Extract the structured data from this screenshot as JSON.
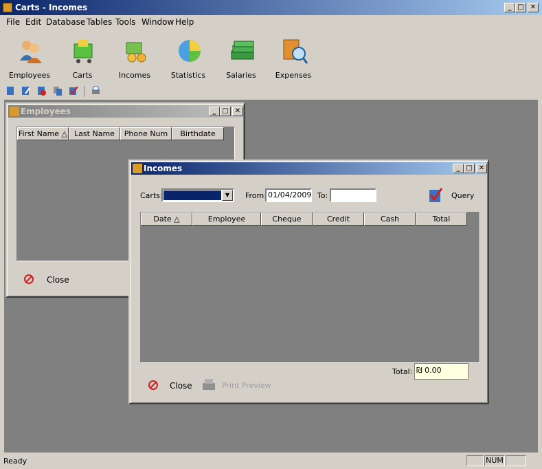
{
  "app": {
    "title": "Carts - Incomes"
  },
  "menu": {
    "file": "File",
    "edit": "Edit",
    "database": "Database",
    "tables": "Tables",
    "tools": "Tools",
    "window": "Window",
    "help": "Help"
  },
  "toolbar": {
    "employees": "Employees",
    "carts": "Carts",
    "incomes": "Incomes",
    "statistics": "Statistics",
    "salaries": "Salaries",
    "expenses": "Expenses"
  },
  "employees_window": {
    "title": "Employees",
    "columns": [
      "First Name",
      "Last Name",
      "Phone Num",
      "Birthdate"
    ],
    "close_label": "Close"
  },
  "incomes_window": {
    "title": "Incomes",
    "carts_label": "Carts:",
    "carts_value": "",
    "from_label": "From:",
    "from_value": "01/04/2009",
    "to_label": "To:",
    "to_value": "",
    "query_label": "Query",
    "columns": [
      "Date",
      "Employee",
      "Cheque",
      "Credit",
      "Cash",
      "Total"
    ],
    "total_label": "Total:",
    "total_value": "₪ 0.00",
    "close_label": "Close",
    "print_preview_label": "Print Preview"
  },
  "statusbar": {
    "text": "Ready",
    "num": "NUM"
  },
  "colors": {
    "titlebar_start": "#0a246a",
    "titlebar_end": "#a6caf0",
    "mdi_bg": "#808080",
    "face": "#d4d0c8"
  }
}
